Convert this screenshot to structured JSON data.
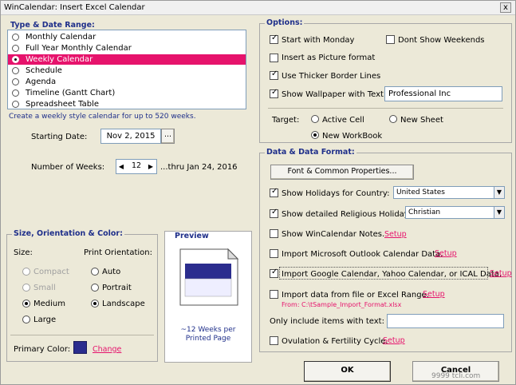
{
  "window": {
    "title": "WinCalendar: Insert Excel Calendar",
    "close": "x"
  },
  "type_range": {
    "title": "Type & Date Range:",
    "items": [
      {
        "label": "Monthly Calendar",
        "selected": false
      },
      {
        "label": "Full Year Monthly Calendar",
        "selected": false
      },
      {
        "label": "Weekly Calendar",
        "selected": true
      },
      {
        "label": "Schedule",
        "selected": false
      },
      {
        "label": "Agenda",
        "selected": false
      },
      {
        "label": "Timeline (Gantt Chart)",
        "selected": false
      },
      {
        "label": "Spreadsheet Table",
        "selected": false
      }
    ],
    "description": "Create a weekly style calendar for up to 520 weeks.",
    "starting_date_label": "Starting Date:",
    "starting_date_value": "Nov 2, 2015",
    "date_button": "...",
    "weeks_label": "Number of Weeks:",
    "weeks_value": "12",
    "weeks_thru": "...thru Jan 24, 2016"
  },
  "size_orientation": {
    "title": "Size, Orientation & Color:",
    "size_label": "Size:",
    "sizes": [
      "Compact",
      "Small",
      "Medium",
      "Large"
    ],
    "print_label": "Print Orientation:",
    "orientations": [
      "Auto",
      "Portrait",
      "Landscape"
    ],
    "primary_color_label": "Primary Color:",
    "primary_color": "#2b2d8e",
    "change_link": "Change"
  },
  "preview": {
    "title": "Preview",
    "caption": "~12 Weeks per Printed Page"
  },
  "options": {
    "title": "Options:",
    "start_monday": "Start with Monday",
    "dont_show_weekends": "Dont Show Weekends",
    "insert_picture": "Insert as Picture format",
    "thicker_borders": "Use Thicker Border Lines",
    "show_wallpaper": "Show Wallpaper with Text:",
    "wallpaper_text": "Professional Inc",
    "target_label": "Target:",
    "active_cell": "Active Cell",
    "new_sheet": "New Sheet",
    "new_workbook": "New WorkBook"
  },
  "data_format": {
    "title": "Data & Data Format:",
    "font_button": "Font & Common Properties...",
    "holidays": "Show Holidays for Country:",
    "holidays_value": "United States",
    "religious": "Show detailed Religious Holidays:",
    "religious_value": "Christian",
    "wincal_notes": "Show WinCalendar Notes.",
    "outlook": "Import Microsoft Outlook Calendar Data.",
    "google": "Import Google Calendar, Yahoo Calendar, or ICAL Data.",
    "excel_import": "Import data from file or Excel Range.",
    "excel_from": "From: C:\\tSample_Import_Format.xlsx",
    "only_include": "Only include items with text:",
    "ovulation": "Ovulation & Fertility Cycle.",
    "setup": "Setup"
  },
  "buttons": {
    "ok": "OK",
    "cancel": "Cancel"
  },
  "watermark": "9999 tcli.com"
}
